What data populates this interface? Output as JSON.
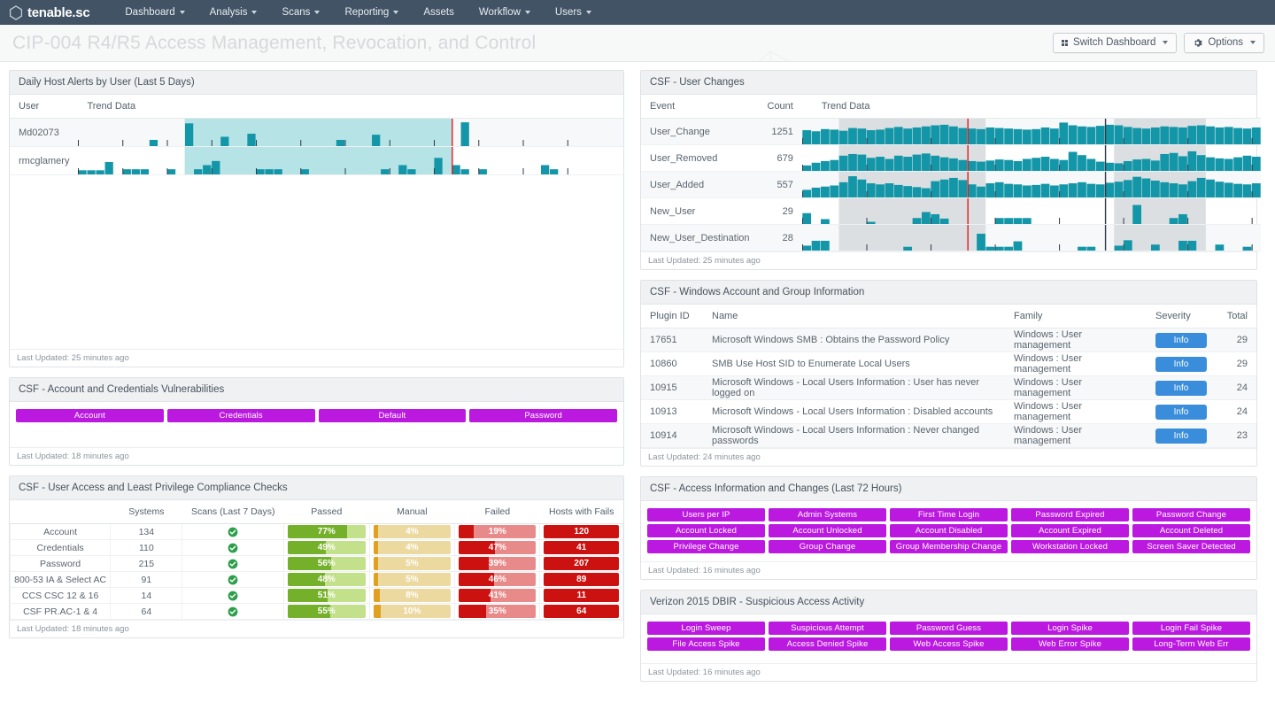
{
  "nav": {
    "brand": "tenable.sc",
    "items": [
      {
        "label": "Dashboard",
        "caret": true
      },
      {
        "label": "Analysis",
        "caret": true
      },
      {
        "label": "Scans",
        "caret": true
      },
      {
        "label": "Reporting",
        "caret": true
      },
      {
        "label": "Assets",
        "caret": false
      },
      {
        "label": "Workflow",
        "caret": true
      },
      {
        "label": "Users",
        "caret": true
      }
    ]
  },
  "titlebar": {
    "title": "CIP-004 R4/R5 Access Management, Revocation, and Control",
    "switch_dashboard": "Switch Dashboard",
    "options": "Options"
  },
  "colors": {
    "navbar": "#415365",
    "teal": "#1296a8",
    "purple": "#bb19e0",
    "blue": "#3a8ddb",
    "green_fill": "#74b02a",
    "green_track": "#c3e08a",
    "amber_fill": "#e0a020",
    "amber_track": "#ecd9a0",
    "red_fill": "#cc1111",
    "red_track": "#e88a8a",
    "band": "#dcdfe1",
    "marker_red": "#e01b1b",
    "marker_dark": "#2f3b49",
    "highlight_cyan": "#b6e3e6"
  },
  "panels": {
    "daily_host_alerts": {
      "title": "Daily Host Alerts by User (Last 5 Days)",
      "columns": [
        "User",
        "Trend Data"
      ],
      "rows": [
        {
          "user": "Md02073"
        },
        {
          "user": "rmcglamery"
        }
      ],
      "footer": "Last Updated: 25 minutes ago"
    },
    "account_credentials_vulns": {
      "title": "CSF - Account and Credentials Vulnerabilities",
      "pills": [
        "Account",
        "Credentials",
        "Default",
        "Password"
      ],
      "footer": "Last Updated: 18 minutes ago"
    },
    "least_privilege": {
      "title": "CSF - User Access and Least Privilege Compliance Checks",
      "columns": [
        "",
        "Systems",
        "Scans (Last 7 Days)",
        "Passed",
        "Manual",
        "Failed",
        "Hosts with Fails"
      ],
      "rows": [
        {
          "name": "Account",
          "systems": "134",
          "scanned": true,
          "passed": "77%",
          "manual": "4%",
          "failed": "19%",
          "hosts_with_fails": "120"
        },
        {
          "name": "Credentials",
          "systems": "110",
          "scanned": true,
          "passed": "49%",
          "manual": "4%",
          "failed": "47%",
          "hosts_with_fails": "41"
        },
        {
          "name": "Password",
          "systems": "215",
          "scanned": true,
          "passed": "56%",
          "manual": "5%",
          "failed": "39%",
          "hosts_with_fails": "207"
        },
        {
          "name": "800-53 IA & Select AC",
          "systems": "91",
          "scanned": true,
          "passed": "48%",
          "manual": "5%",
          "failed": "46%",
          "hosts_with_fails": "89"
        },
        {
          "name": "CCS CSC 12 & 16",
          "systems": "14",
          "scanned": true,
          "passed": "51%",
          "manual": "8%",
          "failed": "41%",
          "hosts_with_fails": "11"
        },
        {
          "name": "CSF PR.AC-1 & 4",
          "systems": "64",
          "scanned": true,
          "passed": "55%",
          "manual": "10%",
          "failed": "35%",
          "hosts_with_fails": "64"
        }
      ],
      "footer": "Last Updated: 18 minutes ago"
    },
    "user_changes": {
      "title": "CSF - User Changes",
      "columns": [
        "Event",
        "Count",
        "Trend Data"
      ],
      "rows": [
        {
          "event": "User_Change",
          "count": "1251"
        },
        {
          "event": "User_Removed",
          "count": "679"
        },
        {
          "event": "User_Added",
          "count": "557"
        },
        {
          "event": "New_User",
          "count": "29"
        },
        {
          "event": "New_User_Destination",
          "count": "28"
        }
      ],
      "footer": "Last Updated: 25 minutes ago"
    },
    "windows_account_group": {
      "title": "CSF - Windows Account and Group Information",
      "columns": [
        "Plugin ID",
        "Name",
        "Family",
        "Severity",
        "Total"
      ],
      "rows": [
        {
          "plugin_id": "17651",
          "name": "Microsoft Windows SMB : Obtains the Password Policy",
          "family": "Windows : User management",
          "severity": "Info",
          "total": "29"
        },
        {
          "plugin_id": "10860",
          "name": "SMB Use Host SID to Enumerate Local Users",
          "family": "Windows : User management",
          "severity": "Info",
          "total": "29"
        },
        {
          "plugin_id": "10915",
          "name": "Microsoft Windows - Local Users Information : User has never logged on",
          "family": "Windows : User management",
          "severity": "Info",
          "total": "24"
        },
        {
          "plugin_id": "10913",
          "name": "Microsoft Windows - Local Users Information : Disabled accounts",
          "family": "Windows : User management",
          "severity": "Info",
          "total": "24"
        },
        {
          "plugin_id": "10914",
          "name": "Microsoft Windows - Local Users Information : Never changed passwords",
          "family": "Windows : User management",
          "severity": "Info",
          "total": "23"
        }
      ],
      "footer": "Last Updated: 24 minutes ago"
    },
    "access_info_changes": {
      "title": "CSF - Access Information and Changes (Last 72 Hours)",
      "pills": [
        "Users per IP",
        "Admin Systems",
        "First Time Login",
        "Password Expired",
        "Password Change",
        "Account Locked",
        "Account Unlocked",
        "Account Disabled",
        "Account Expired",
        "Account Deleted",
        "Privilege Change",
        "Group Change",
        "Group Membership Change",
        "Workstation Locked",
        "Screen Saver Detected"
      ],
      "footer": "Last Updated: 16 minutes ago"
    },
    "dbir_suspicious": {
      "title": "Verizon 2015 DBIR - Suspicious Access Activity",
      "pills": [
        "Login Sweep",
        "Suspicious Attempt",
        "Password Guess",
        "Login Spike",
        "Login Fail Spike",
        "File Access Spike",
        "Access Denied Spike",
        "Web Access Spike",
        "Web Error Spike",
        "Long-Term Web Err"
      ],
      "footer": "Last Updated: 16 minutes ago"
    }
  },
  "chart_data": [
    {
      "type": "bar",
      "title": "Daily Host Alerts by User (Last 5 Days)",
      "name": "daily-host-alerts",
      "ylabel": "",
      "xlabel": "",
      "series": [
        {
          "name": "Md02073",
          "values": [
            0,
            0,
            0,
            0,
            0,
            0,
            0,
            0,
            6,
            0,
            0,
            0,
            22,
            0,
            0,
            0,
            9,
            0,
            0,
            12,
            0,
            0,
            0,
            0,
            0,
            0,
            0,
            0,
            0,
            6,
            0,
            0,
            0,
            11,
            0,
            0,
            0,
            0,
            0,
            0,
            0,
            0,
            0,
            23,
            0,
            0,
            0,
            0,
            0,
            0,
            0,
            0,
            0,
            0,
            0,
            0,
            0,
            0,
            0,
            0
          ]
        },
        {
          "name": "rmcglamery",
          "values": [
            4,
            4,
            4,
            12,
            0,
            5,
            5,
            5,
            0,
            0,
            5,
            0,
            0,
            5,
            9,
            13,
            0,
            0,
            0,
            0,
            5,
            5,
            5,
            0,
            0,
            5,
            0,
            0,
            0,
            0,
            0,
            0,
            0,
            0,
            5,
            0,
            9,
            5,
            0,
            0,
            16,
            0,
            9,
            5,
            0,
            5,
            0,
            0,
            0,
            0,
            0,
            0,
            9,
            5,
            0,
            0,
            0,
            0,
            0,
            0
          ]
        }
      ],
      "highlight_band": {
        "start": 12,
        "end": 42,
        "color": "#b6e3e6"
      },
      "marker_line": {
        "x": 42,
        "color": "#e01b1b"
      }
    },
    {
      "type": "bar",
      "title": "CSF - User Changes",
      "name": "user-changes-trend",
      "series": [
        {
          "name": "User_Change",
          "count": 1251,
          "values": [
            52,
            48,
            56,
            54,
            50,
            60,
            58,
            52,
            54,
            60,
            64,
            58,
            62,
            66,
            70,
            72,
            66,
            60,
            58,
            56,
            62,
            60,
            58,
            56,
            54,
            56,
            62,
            58,
            80,
            70,
            66,
            64,
            68,
            72,
            70,
            64,
            60,
            58,
            62,
            66,
            64,
            62,
            68,
            70,
            66,
            62,
            64,
            60,
            58,
            62
          ]
        },
        {
          "name": "User_Removed",
          "count": 679,
          "values": [
            20,
            30,
            36,
            40,
            56,
            62,
            60,
            48,
            52,
            44,
            56,
            52,
            60,
            64,
            56,
            50,
            46,
            40,
            36,
            34,
            38,
            42,
            40,
            36,
            44,
            48,
            52,
            44,
            40,
            70,
            58,
            44,
            34,
            30,
            28,
            36,
            42,
            44,
            38,
            62,
            66,
            54,
            72,
            58,
            50,
            46,
            44,
            50,
            56,
            52
          ]
        },
        {
          "name": "User_Added",
          "count": 557,
          "values": [
            28,
            36,
            40,
            44,
            56,
            78,
            66,
            52,
            48,
            52,
            46,
            42,
            38,
            34,
            60,
            66,
            72,
            64,
            48,
            40,
            52,
            56,
            50,
            48,
            44,
            46,
            50,
            44,
            48,
            52,
            56,
            50,
            48,
            54,
            58,
            64,
            76,
            70,
            62,
            56,
            52,
            48,
            60,
            72,
            66,
            58,
            54,
            50,
            48,
            52
          ]
        },
        {
          "name": "New_User",
          "count": 29,
          "values": [
            40,
            0,
            18,
            0,
            0,
            0,
            0,
            8,
            0,
            0,
            0,
            0,
            22,
            44,
            36,
            20,
            0,
            0,
            0,
            0,
            0,
            22,
            22,
            22,
            22,
            0,
            0,
            0,
            0,
            0,
            0,
            0,
            0,
            0,
            0,
            0,
            70,
            0,
            0,
            0,
            22,
            36,
            0,
            0,
            0,
            0,
            0,
            0,
            0,
            0
          ]
        },
        {
          "name": "New_User_Destination",
          "count": 28,
          "values": [
            18,
            36,
            36,
            0,
            0,
            0,
            0,
            0,
            0,
            0,
            0,
            14,
            0,
            0,
            0,
            0,
            0,
            0,
            0,
            62,
            14,
            14,
            14,
            34,
            0,
            0,
            0,
            0,
            0,
            0,
            14,
            14,
            0,
            0,
            18,
            38,
            0,
            0,
            22,
            0,
            0,
            36,
            36,
            0,
            0,
            22,
            0,
            0,
            14,
            0
          ]
        }
      ],
      "bands": [
        [
          4,
          20
        ],
        [
          34,
          44
        ],
        [
          56,
          70
        ]
      ],
      "marker_lines": [
        {
          "x": 18,
          "color": "#e01b1b"
        },
        {
          "x": 33,
          "color": "#2f3b49"
        }
      ]
    }
  ]
}
